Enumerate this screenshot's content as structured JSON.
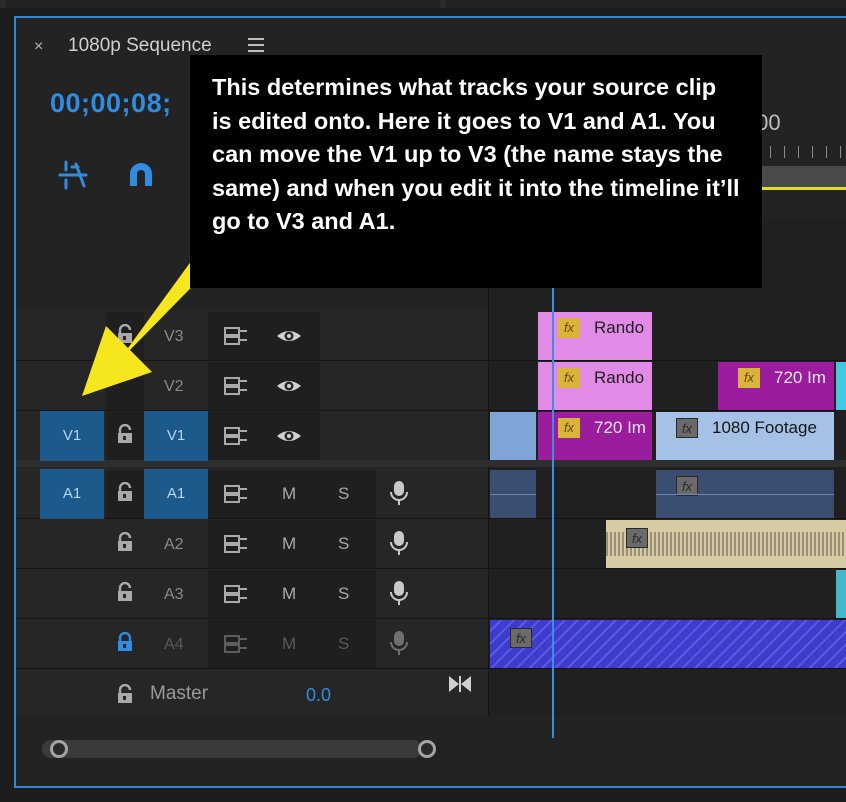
{
  "panel": {
    "close_glyph": "×",
    "title": "1080p Sequence",
    "menu_icon": "hamburger-menu-icon",
    "timecode": "00;00;08;",
    "accent": "#2f86d6",
    "tools": [
      {
        "icon": "snap-icon"
      },
      {
        "icon": "linked-selection-magnet-icon"
      }
    ]
  },
  "ruler": {
    "label": ";00"
  },
  "callout": {
    "text": "This determines what tracks your source clip is edited onto. Here it goes to V1 and A1. You can move the V1 up to V3 (the name stays the same) and when you edit it into the timeline it’ll go to V3 and A1."
  },
  "annotation_arrow": {
    "color": "#f5e61e",
    "icon": "yellow-arrow-icon"
  },
  "video_tracks": [
    {
      "name": "V3",
      "source": "",
      "sync_icon": "sync-lock-icon",
      "output_icon": "eye-icon"
    },
    {
      "name": "V2",
      "source": "",
      "sync_icon": "sync-lock-icon",
      "output_icon": "eye-icon"
    },
    {
      "name": "V1",
      "source": "V1",
      "sync_icon": "sync-lock-icon",
      "output_icon": "eye-icon"
    }
  ],
  "audio_tracks": [
    {
      "name": "A1",
      "source": "A1",
      "mute": "M",
      "solo": "S",
      "locked": false
    },
    {
      "name": "A2",
      "source": "",
      "mute": "M",
      "solo": "S",
      "locked": false
    },
    {
      "name": "A3",
      "source": "",
      "mute": "M",
      "solo": "S",
      "locked": false
    },
    {
      "name": "A4",
      "source": "",
      "mute": "M",
      "solo": "S",
      "locked": true
    }
  ],
  "master": {
    "label": "Master",
    "value": "0.0"
  },
  "clips": {
    "v3": {
      "label": "Rando",
      "fx": "fx"
    },
    "v2a": {
      "label": "Rando",
      "fx": "fx"
    },
    "v2b": {
      "label": "720 Im",
      "fx": "fx"
    },
    "v1a": {
      "label": "720 Im",
      "fx": "fx"
    },
    "v1b": {
      "label": "1080 Footage",
      "fx": "fx"
    },
    "a1b": {
      "fx": "fx"
    },
    "a2": {
      "fx": "fx"
    },
    "a4": {
      "fx": "fx"
    }
  }
}
